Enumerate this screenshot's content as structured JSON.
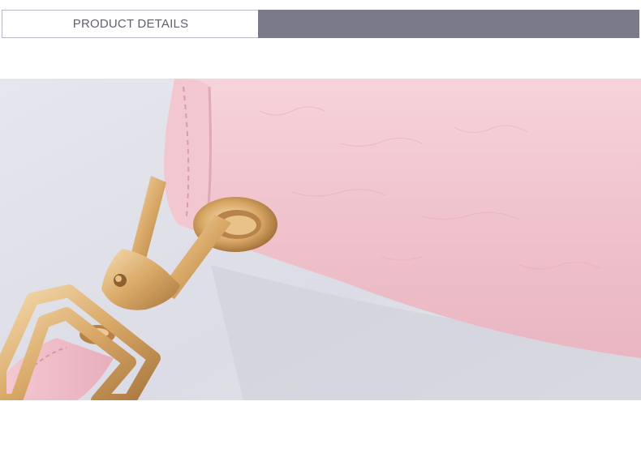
{
  "header": {
    "title": "PRODUCT DETAILS",
    "accent_color": "#7b7a8a"
  },
  "photo": {
    "subject": "pink-leather-bag-strap-with-gold-clasp",
    "colors": {
      "background": "#e4e4ec",
      "leather": "#f2c6cf",
      "hardware": "#e0b47a"
    }
  }
}
